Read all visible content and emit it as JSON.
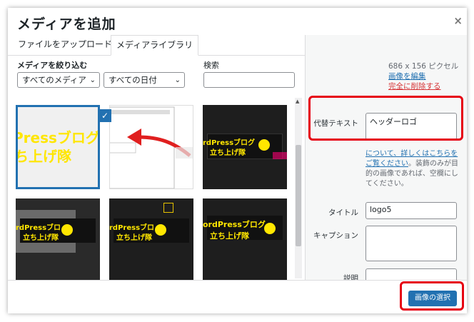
{
  "modal": {
    "title": "メディアを追加",
    "close_glyph": "×"
  },
  "tabs": [
    {
      "label": "ファイルをアップロード"
    },
    {
      "label": "メディアライブラリ"
    }
  ],
  "filters": {
    "label": "メディアを絞り込む",
    "type_value": "すべてのメディア",
    "date_value": "すべての日付",
    "search_label": "検索",
    "search_value": ""
  },
  "thumbs": [
    {
      "text_line1": "Pressブログ",
      "text_line2": "ち上げ隊",
      "selected": true
    },
    {
      "text_line1": "",
      "text_line2": ""
    },
    {
      "text_line1": "rdPressブログ",
      "text_line2": "立ち上げ隊"
    },
    {
      "text_line1": "rdPressブログ",
      "text_line2": "立ち上げ隊"
    },
    {
      "text_line1": "rdPressブログ",
      "text_line2": "立ち上げ隊"
    },
    {
      "text_line1": "ordPressブログ",
      "text_line2": "立ち上げ隊"
    }
  ],
  "details": {
    "dimensions": "686 x 156 ピクセル",
    "edit_link": "画像を編集",
    "delete_link": "完全に削除する",
    "alt_label": "代替テキスト",
    "alt_value": "ヘッダーロゴ",
    "help_link": "について、詳しくはこちらをご覧ください",
    "help_text": "。装飾のみが目的の画像であれば、空欄にしてください。",
    "title_label": "タイトル",
    "title_value": "logo5",
    "caption_label": "キャプション",
    "caption_value": "",
    "desc_label": "説明",
    "desc_value": ""
  },
  "footer": {
    "select_button": "画像の選択"
  },
  "colors": {
    "primary": "#2271b1",
    "highlight": "#e60012",
    "danger": "#d63638",
    "logo_yellow": "#ffe600"
  }
}
